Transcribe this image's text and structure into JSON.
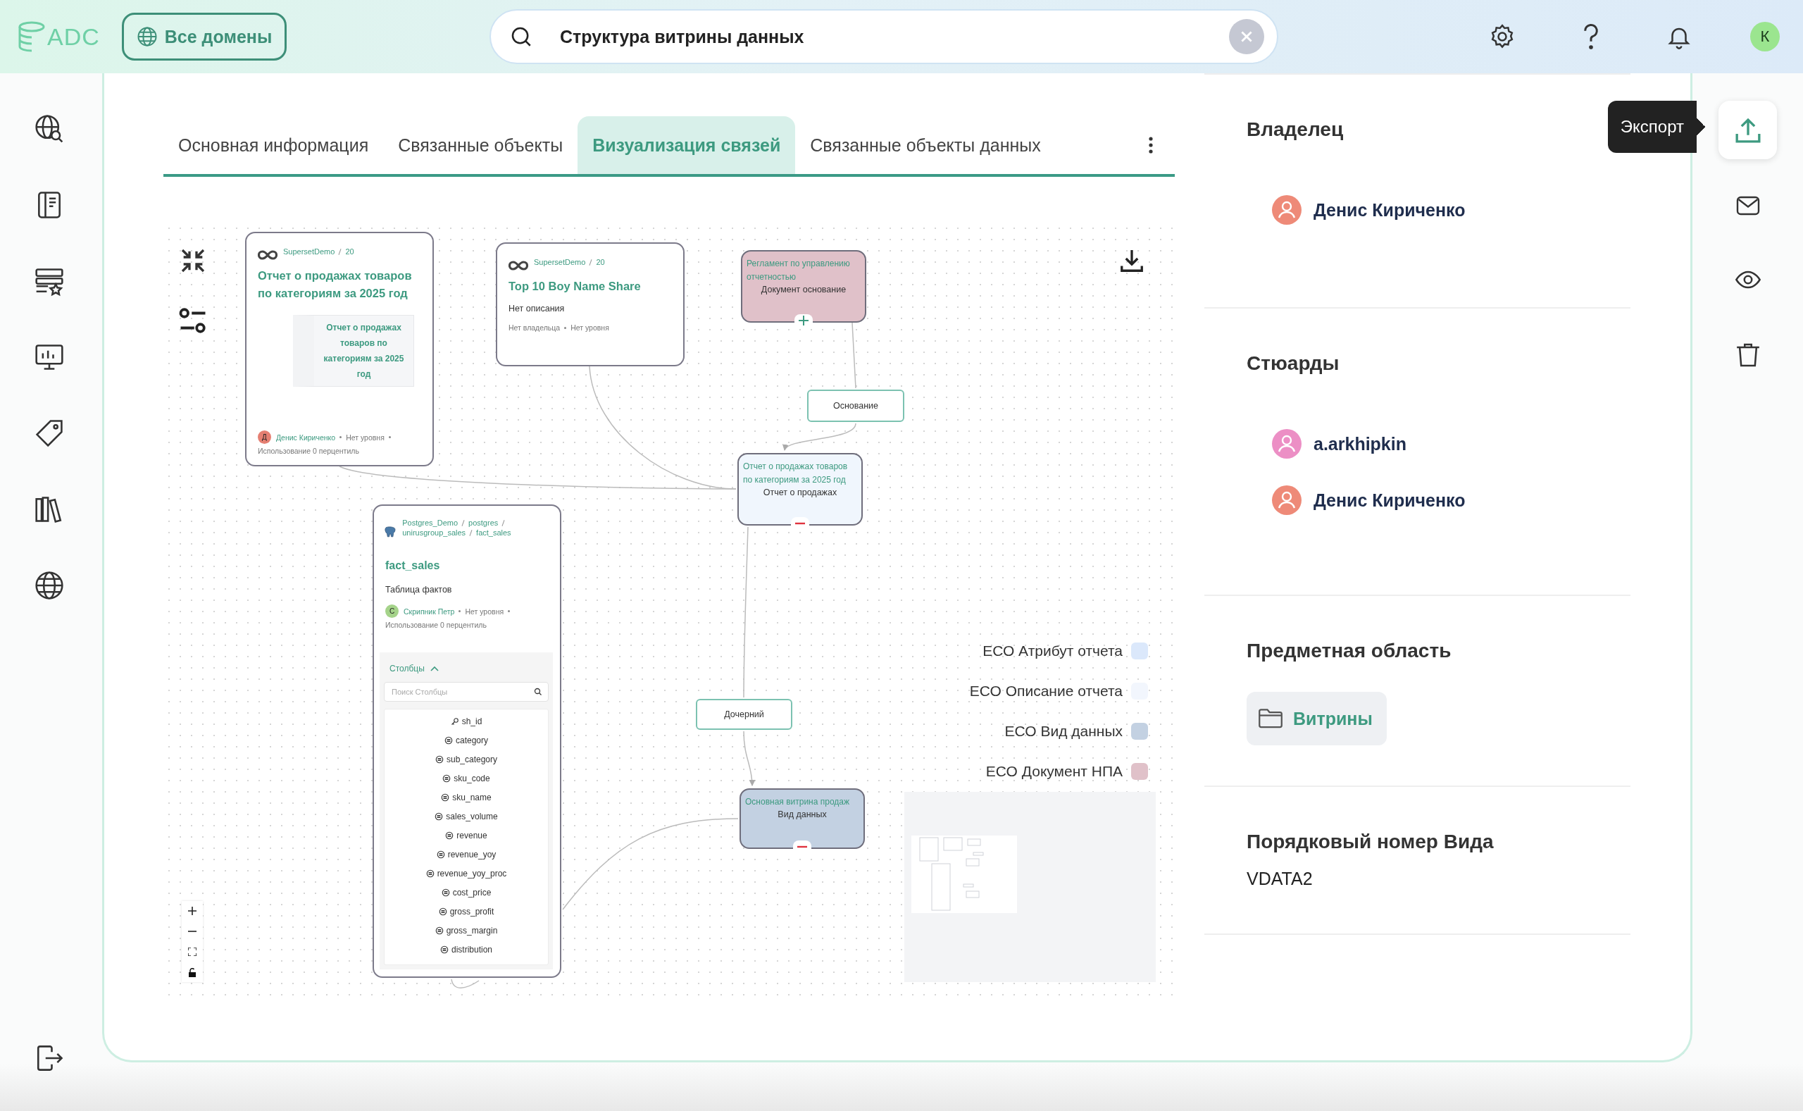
{
  "header": {
    "logo": "ADC",
    "domain_button": "Все домены",
    "search": {
      "value": "Структура витрины данных"
    },
    "avatar": "К"
  },
  "tabs": [
    {
      "label": "Основная информация",
      "selected": false
    },
    {
      "label": "Связанные объекты",
      "selected": false
    },
    {
      "label": "Визуализация связей",
      "selected": true
    },
    {
      "label": "Связанные объекты данных",
      "selected": false
    }
  ],
  "graph": {
    "cards": [
      {
        "breadcrumb": [
          "SupersetDemo",
          "20"
        ],
        "title": "Отчет о продажах товаров по категориям за 2025 год",
        "preview": "Отчет о продажах товаров по категориям за 2025 год",
        "footer": [
          {
            "kind": "person",
            "initial": "Д",
            "name": "Денис Кириченко",
            "color": "#e57f72"
          },
          {
            "kind": "text",
            "text": "Нет уровня"
          },
          {
            "kind": "text",
            "text": "Использование 0 перцентиль"
          }
        ]
      },
      {
        "breadcrumb": [
          "SupersetDemo",
          "20"
        ],
        "title": "Top 10 Boy Name Share",
        "description": "Нет описания",
        "footer": [
          {
            "kind": "text",
            "text": "Нет владельца"
          },
          {
            "kind": "text",
            "text": "Нет уровня"
          }
        ]
      }
    ],
    "table": {
      "breadcrumb": [
        "Postgres_Demo",
        "postgres",
        "unirusgroup_sales",
        "fact_sales"
      ],
      "title": "fact_sales",
      "description": "Таблица фактов",
      "footer": [
        {
          "kind": "person",
          "initial": "С",
          "name": "Скрипник Петр",
          "color": "#a5d38a"
        },
        {
          "kind": "text",
          "text": "Нет уровня"
        },
        {
          "kind": "text",
          "text": "Использование 0 перцентиль"
        }
      ],
      "columns_section": {
        "label": "Столбцы",
        "expanded": true,
        "search_placeholder": "Поиск Столбцы",
        "columns": [
          {
            "name": "sh_id",
            "kind": "key"
          },
          {
            "name": "category",
            "kind": "nullable"
          },
          {
            "name": "sub_category",
            "kind": "nullable"
          },
          {
            "name": "sku_code",
            "kind": "nullable"
          },
          {
            "name": "sku_name",
            "kind": "nullable"
          },
          {
            "name": "sales_volume",
            "kind": "nullable"
          },
          {
            "name": "revenue",
            "kind": "nullable"
          },
          {
            "name": "revenue_yoy",
            "kind": "nullable"
          },
          {
            "name": "revenue_yoy_proc",
            "kind": "nullable"
          },
          {
            "name": "cost_price",
            "kind": "nullable"
          },
          {
            "name": "gross_profit",
            "kind": "nullable"
          },
          {
            "name": "gross_margin",
            "kind": "nullable"
          },
          {
            "name": "distribution",
            "kind": "nullable"
          }
        ]
      }
    },
    "entities": [
      {
        "title": "Регламент по управлению отчетностью",
        "type": "Документ основание",
        "color": "#e0c1c9",
        "expanded": false
      },
      {
        "title": "Отчет о продажах товаров по категориям за 2025 год",
        "type": "Отчет о продажах",
        "color": "#f0f6fd",
        "expanded": true
      },
      {
        "title": "Основная витрина продаж",
        "type": "Вид данных",
        "color": "#c3d1e2",
        "expanded": true
      }
    ],
    "edge_labels": [
      "Основание",
      "Дочерний"
    ],
    "legend": [
      {
        "label": "ЕСО Атрибут отчета",
        "color": "#dbe8fb"
      },
      {
        "label": "ЕСО Описание отчета",
        "color": "#f2f6fd"
      },
      {
        "label": "ЕСО Вид данных",
        "color": "#c3d1e2"
      },
      {
        "label": "ЕСО Документ НПА",
        "color": "#e0c1c9"
      }
    ]
  },
  "details": [
    {
      "heading": "Владелец",
      "kind": "people",
      "people": [
        {
          "name": "Денис Кириченко",
          "color": "#ee8a78"
        }
      ]
    },
    {
      "heading": "Стюарды",
      "kind": "people",
      "people": [
        {
          "name": "a.arkhipkin",
          "color": "#ec8fc5"
        },
        {
          "name": "Денис Кириченко",
          "color": "#ee8a78"
        }
      ]
    },
    {
      "heading": "Предметная область",
      "kind": "chip",
      "value": "Витрины"
    },
    {
      "heading": "Порядковый номер Вида",
      "kind": "text",
      "value": "VDATA2"
    }
  ],
  "actions": {
    "tooltip": "Экспорт"
  }
}
